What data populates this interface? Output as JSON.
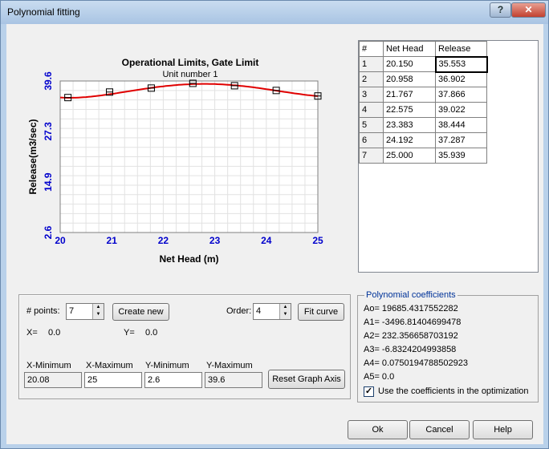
{
  "window": {
    "title": "Polynomial fitting",
    "help_glyph": "?",
    "close_glyph": "✕"
  },
  "chart_data": {
    "type": "line",
    "title": "Operational Limits, Gate Limit",
    "subtitle": "Unit number 1",
    "xlabel": "Net Head (m)",
    "ylabel": "Release(m3/sec)",
    "xlim": [
      20,
      25
    ],
    "ylim": [
      2.6,
      39.6
    ],
    "x_ticks": [
      "20",
      "21",
      "22",
      "23",
      "24",
      "25"
    ],
    "y_ticks": [
      "2.6",
      "14.9",
      "27.3",
      "39.6"
    ],
    "grid": true,
    "series": [
      {
        "x": [
          20.15,
          20.958,
          21.767,
          22.575,
          23.383,
          24.192,
          25.0
        ],
        "y": [
          35.553,
          36.902,
          37.866,
          39.022,
          38.444,
          37.287,
          35.939
        ]
      }
    ],
    "line_color": "#e00000",
    "tick_color": "#0000cc"
  },
  "table": {
    "headers": [
      "#",
      "Net Head",
      "Release"
    ],
    "rows": [
      [
        "1",
        "20.150",
        "35.553"
      ],
      [
        "2",
        "20.958",
        "36.902"
      ],
      [
        "3",
        "21.767",
        "37.866"
      ],
      [
        "4",
        "22.575",
        "39.022"
      ],
      [
        "5",
        "23.383",
        "38.444"
      ],
      [
        "6",
        "24.192",
        "37.287"
      ],
      [
        "7",
        "25.000",
        "35.939"
      ]
    ]
  },
  "controls": {
    "points_label": "# points:",
    "points_value": "7",
    "create_new": "Create new",
    "order_label": "Order:",
    "order_value": "4",
    "fit_curve": "Fit curve",
    "x_label": "X=",
    "x_value": "0.0",
    "y_label": "Y=",
    "y_value": "0.0",
    "xmin_label": "X-Minimum",
    "xmin_value": "20.08",
    "xmax_label": "X-Maximum",
    "xmax_value": "25",
    "ymin_label": "Y-Minimum",
    "ymin_value": "2.6",
    "ymax_label": "Y-Maximum",
    "ymax_value": "39.6",
    "reset_axis": "Reset Graph Axis"
  },
  "coefficients": {
    "legend": "Polynomial coefficients",
    "lines": [
      "Ao= 19685.4317552282",
      "A1= -3496.81404699478",
      "A2= 232.356658703192",
      "A3= -6.8324204993858",
      "A4= 0.0750194788502923",
      "A5= 0.0"
    ],
    "use_label": "Use the coefficients in the optimization",
    "use_checked": true
  },
  "buttons": {
    "ok": "Ok",
    "cancel": "Cancel",
    "help": "Help"
  }
}
